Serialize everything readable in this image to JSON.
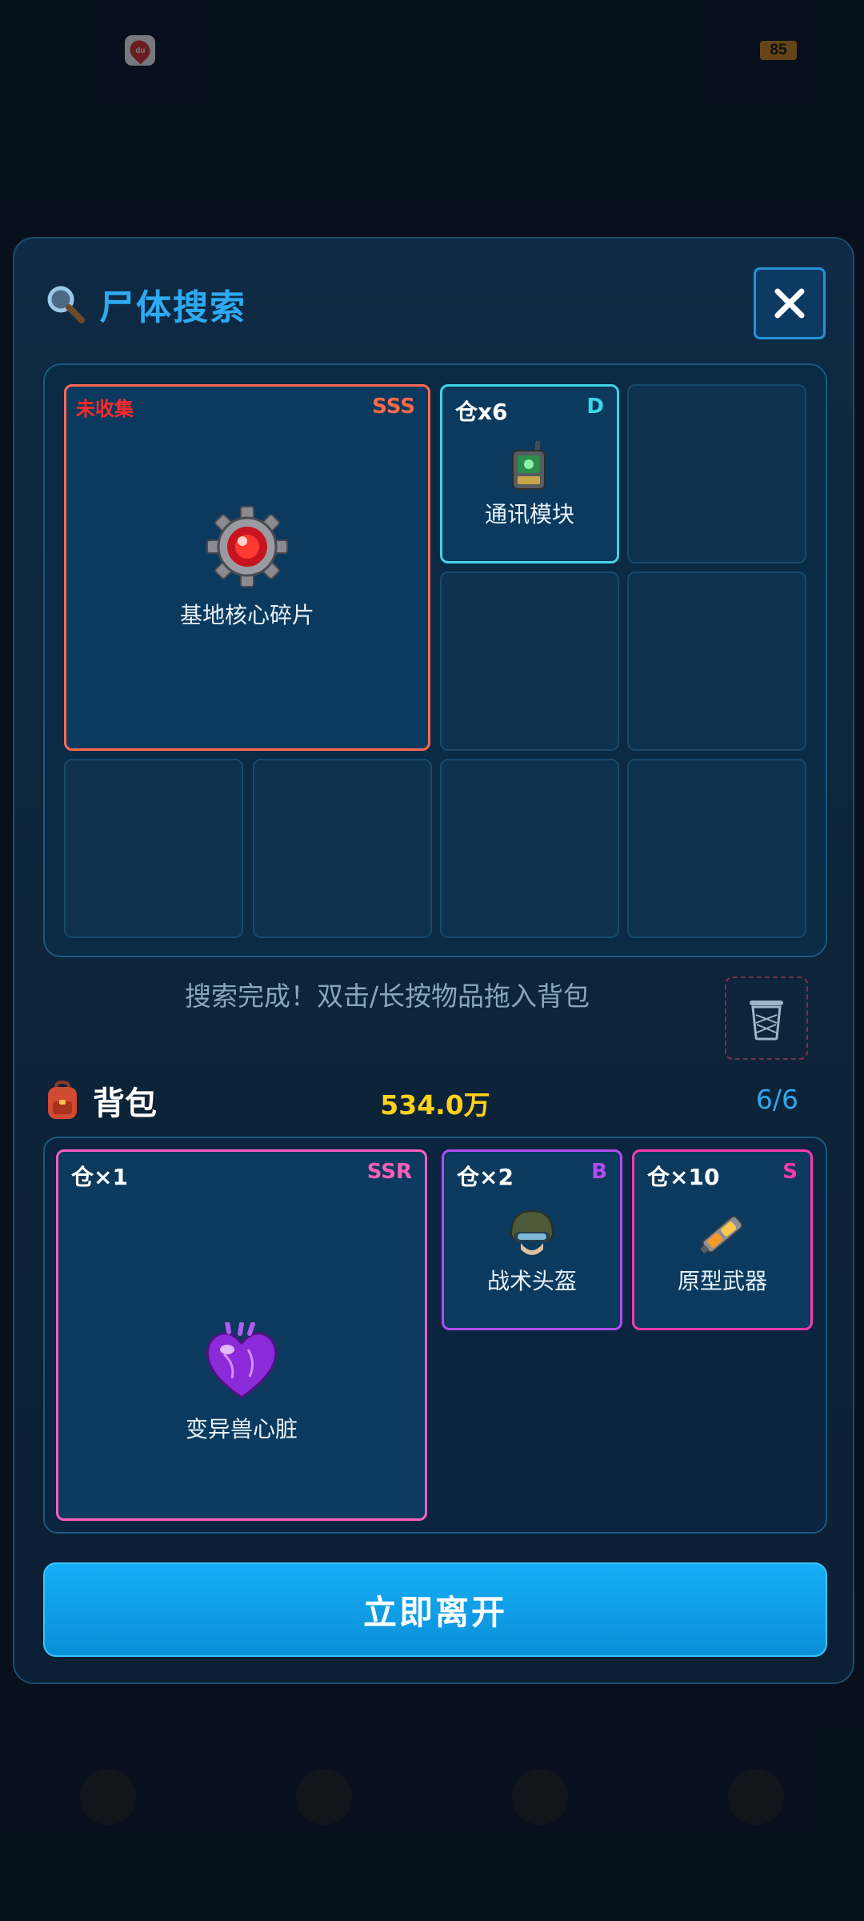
{
  "status_bar": {
    "battery": "85",
    "app_badge": "du"
  },
  "modal": {
    "title": "尸体搜索",
    "loot": [
      {
        "name": "基地核心碎片",
        "rarity": "SSS",
        "tag": "未收集",
        "rarity_color": "#ff6a4a",
        "border_color": "#ff6a52"
      },
      {
        "name": "通讯模块",
        "rarity": "D",
        "qty": "仓x6",
        "rarity_color": "#38d8e6",
        "border_color": "#44d2e6"
      }
    ],
    "hint": "搜索完成！双击/长按物品拖入背包",
    "bag": {
      "title": "背包",
      "value": "534.0万",
      "count": "6/6",
      "items": [
        {
          "name": "变异兽心脏",
          "rarity": "SSR",
          "qty": "仓×1",
          "rarity_color": "#ff5fb8",
          "border_color": "#ff5fc0"
        },
        {
          "name": "战术头盔",
          "rarity": "B",
          "qty": "仓×2",
          "rarity_color": "#b14df0",
          "border_color": "#b04cf0"
        },
        {
          "name": "原型武器",
          "rarity": "S",
          "qty": "仓×10",
          "rarity_color": "#ff3aa8",
          "border_color": "#ff3aa8"
        }
      ]
    },
    "leave_button": "立即离开"
  }
}
